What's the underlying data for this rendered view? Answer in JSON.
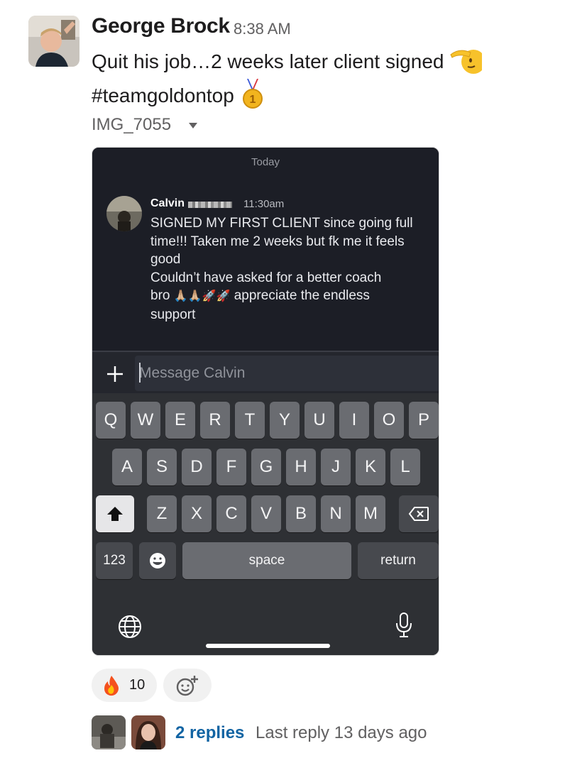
{
  "message": {
    "author": "George Brock",
    "time": "8:38 AM",
    "text_line1": "Quit his job…2 weeks later client signed",
    "text_line2": "#teamgoldontop",
    "emojis": [
      "saluting-face-emoji",
      "gold-medal-emoji"
    ]
  },
  "attachment": {
    "file_name": "IMG_7055"
  },
  "screenshot": {
    "date_divider": "Today",
    "sender_name": "Calvin",
    "sender_time": "11:30am",
    "text_lines": [
      "SIGNED MY FIRST CLIENT since going full",
      "time!!! Taken me 2 weeks but fk me it feels",
      "good",
      "Couldn’t have asked for a better coach",
      "appreciate the endless",
      "support"
    ],
    "line5_prefix": "bro",
    "line5_emojis": "🙏🏼🙏🏼🚀🚀",
    "input_placeholder": "Message Calvin",
    "keyboard": {
      "row1": [
        "Q",
        "W",
        "E",
        "R",
        "T",
        "Y",
        "U",
        "I",
        "O",
        "P"
      ],
      "row2": [
        "A",
        "S",
        "D",
        "F",
        "G",
        "H",
        "J",
        "K",
        "L"
      ],
      "row3": [
        "Z",
        "X",
        "C",
        "V",
        "B",
        "N",
        "M"
      ],
      "numbers_key": "123",
      "space_key": "space",
      "return_key": "return"
    }
  },
  "reactions": [
    {
      "emoji": "🔥",
      "count": "10"
    }
  ],
  "thread": {
    "replies_label": "2 replies",
    "last_reply": "Last reply 13 days ago"
  },
  "colors": {
    "link": "#1264a3",
    "phone_bg": "#1c1e26",
    "key_bg": "#6a6c71"
  }
}
